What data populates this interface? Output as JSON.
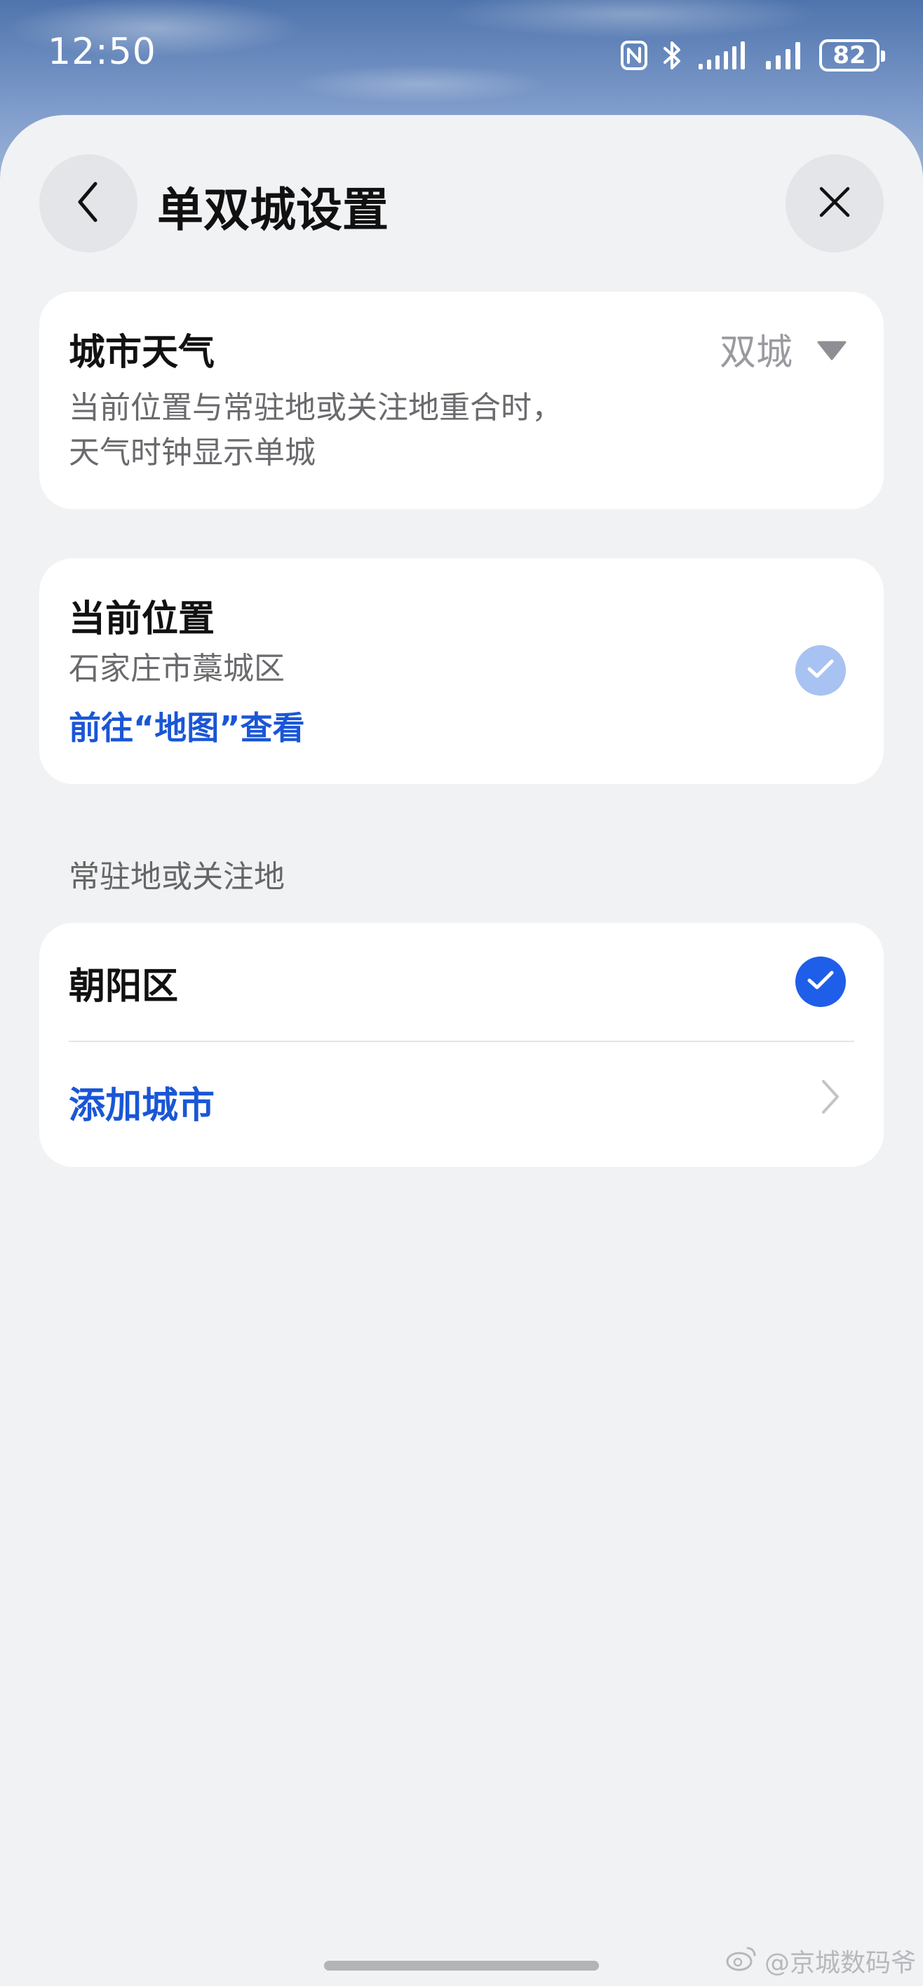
{
  "status_bar": {
    "time": "12:50",
    "battery_level": "82",
    "icons": [
      "nfc-icon",
      "bluetooth-icon",
      "signal-icon",
      "signal-icon",
      "battery-icon"
    ]
  },
  "header": {
    "title": "单双城设置",
    "back_icon": "chevron-left-icon",
    "close_icon": "close-icon"
  },
  "city_weather": {
    "title": "城市天气",
    "selected_value": "双城",
    "description_line1": "当前位置与常驻地或关注地重合时，",
    "description_line2": "天气时钟显示单城"
  },
  "current_location": {
    "title": "当前位置",
    "address": "石家庄市藁城区",
    "map_link": "前往“地图”查看",
    "checked": true
  },
  "resident": {
    "section_label": "常驻地或关注地",
    "items": [
      {
        "label": "朝阳区",
        "checked": true
      }
    ],
    "add_label": "添加城市"
  },
  "watermark": "@京城数码爷",
  "colors": {
    "accent": "#1a56d6",
    "check_active": "#1f5ee8",
    "check_disabled": "#a8c2f2",
    "sheet_bg": "#f1f2f4"
  }
}
